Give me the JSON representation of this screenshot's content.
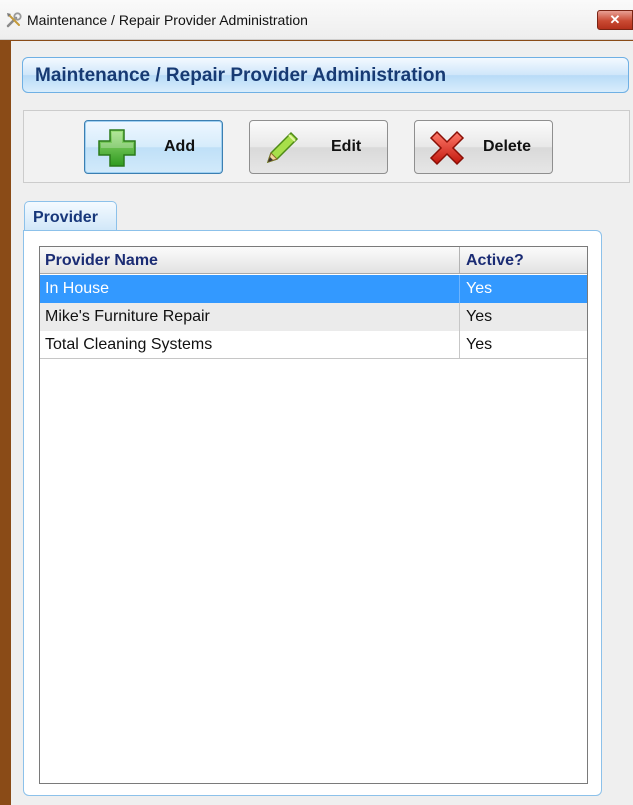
{
  "window": {
    "title": "Maintenance / Repair Provider Administration",
    "close_glyph": "✕"
  },
  "header": {
    "title": "Maintenance / Repair Provider Administration"
  },
  "toolbar": {
    "add_label": "Add",
    "edit_label": "Edit",
    "delete_label": "Delete"
  },
  "tab": {
    "label": "Provider"
  },
  "grid": {
    "columns": [
      "Provider Name",
      "Active?"
    ],
    "rows": [
      {
        "name": "In House",
        "active": "Yes",
        "selected": true
      },
      {
        "name": "Mike's Furniture Repair",
        "active": "Yes",
        "selected": false
      },
      {
        "name": "Total Cleaning Systems",
        "active": "Yes",
        "selected": false
      }
    ]
  },
  "icons": {
    "app": "tools-icon",
    "add": "plus-icon",
    "edit": "pencil-icon",
    "delete": "red-x-icon"
  },
  "colors": {
    "selection": "#3399ff",
    "header_text": "#173a73",
    "window_frame": "#8a4b17"
  }
}
